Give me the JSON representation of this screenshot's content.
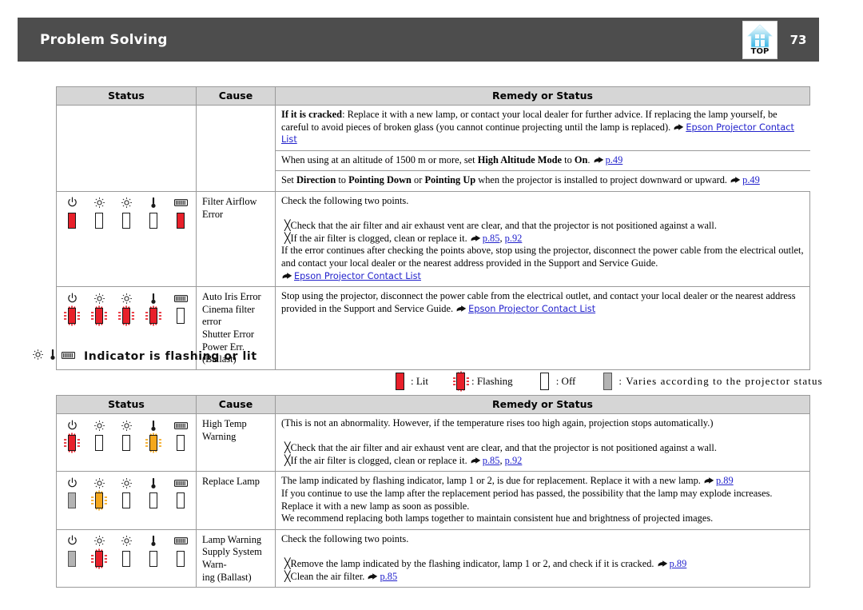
{
  "header": {
    "title": "Problem Solving",
    "page_number": "73",
    "top_icon_label": "TOP",
    "bar_color": "#4d4d4d"
  },
  "colors": {
    "lit": "#e8202a",
    "lit_orange": "#f5a81c",
    "off": "#ffffff",
    "varies": "#b3b3b3",
    "link": "#2222cc",
    "header_fill": "#d6d6d6"
  },
  "table1": {
    "headers": [
      "Status",
      "Cause",
      "Remedy or Status"
    ],
    "rows": [
      {
        "indicators": null,
        "cause": "",
        "remedies": [
          {
            "parts": [
              {
                "t": "b",
                "v": "If it is cracked"
              },
              {
                "t": "n",
                "v": ": Replace it with a new lamp, or contact your local dealer for further advice. If replacing the lamp yourself, be careful to avoid pieces of broken glass (you cannot continue projecting until the lamp is replaced). "
              },
              {
                "t": "hand"
              },
              {
                "t": "link",
                "v": "Epson Projector Contact List"
              }
            ]
          },
          {
            "parts": [
              {
                "t": "n",
                "v": "When using at an altitude of 1500 m or more, set "
              },
              {
                "t": "b",
                "v": "High Altitude Mode"
              },
              {
                "t": "n",
                "v": " to "
              },
              {
                "t": "b",
                "v": "On"
              },
              {
                "t": "n",
                "v": ". "
              },
              {
                "t": "hand"
              },
              {
                "t": "linkser",
                "v": "p.49"
              }
            ]
          },
          {
            "parts": [
              {
                "t": "n",
                "v": "Set "
              },
              {
                "t": "b",
                "v": "Direction"
              },
              {
                "t": "n",
                "v": " to "
              },
              {
                "t": "b",
                "v": "Pointing Down"
              },
              {
                "t": "n",
                "v": " or "
              },
              {
                "t": "b",
                "v": "Pointing Up"
              },
              {
                "t": "n",
                "v": " when the projector is installed to project downward or upward. "
              },
              {
                "t": "hand"
              },
              {
                "t": "linkser",
                "v": "p.49"
              }
            ]
          }
        ]
      },
      {
        "indicators": [
          {
            "icon": "power-icon",
            "state": "lit"
          },
          {
            "icon": "lamp1-icon",
            "state": "off"
          },
          {
            "icon": "lamp2-icon",
            "state": "off"
          },
          {
            "icon": "temp-icon",
            "state": "off"
          },
          {
            "icon": "filter-icon",
            "state": "lit"
          }
        ],
        "cause": "Filter Airflow Error",
        "remedies": [
          {
            "parts": [
              {
                "t": "n",
                "v": "Check the following two points."
              },
              {
                "t": "br"
              },
              {
                "t": "ind",
                "v": "╳Check that the air filter and air exhaust vent are clear, and that the projector is not positioned against a wall."
              },
              {
                "t": "ind2",
                "v": "╳If the air filter is clogged, clean or replace it. "
              },
              {
                "t": "hand"
              },
              {
                "t": "linkser",
                "v": "p.85"
              },
              {
                "t": "n",
                "v": ", "
              },
              {
                "t": "linkser",
                "v": "p.92"
              },
              {
                "t": "br"
              },
              {
                "t": "n",
                "v": "If the error continues after checking the points above, stop using the projector, disconnect the power cable from the electrical outlet, and contact your local dealer or the nearest address provided in the Support and Service Guide."
              },
              {
                "t": "br"
              },
              {
                "t": "hand"
              },
              {
                "t": "link",
                "v": "Epson Projector Contact List"
              }
            ]
          }
        ]
      },
      {
        "indicators": [
          {
            "icon": "power-icon",
            "state": "flash"
          },
          {
            "icon": "lamp1-icon",
            "state": "flash"
          },
          {
            "icon": "lamp2-icon",
            "state": "flash"
          },
          {
            "icon": "temp-icon",
            "state": "flash"
          },
          {
            "icon": "filter-icon",
            "state": "off"
          }
        ],
        "cause_lines": [
          "Auto Iris Error",
          "Cinema filter error",
          "Shutter Error",
          "Power Err. (Ballast)"
        ],
        "remedies": [
          {
            "parts": [
              {
                "t": "n",
                "v": "Stop using the projector, disconnect the power cable from the electrical outlet, and contact your local dealer or the nearest address provided in the Support and Service Guide. "
              },
              {
                "t": "hand"
              },
              {
                "t": "link",
                "v": "Epson Projector Contact List"
              }
            ]
          }
        ]
      }
    ]
  },
  "section": {
    "heading": "Indicator is flashing or lit",
    "heading_icons": [
      "lamp-icon",
      "temp-icon",
      "filter-icon"
    ],
    "legend": [
      {
        "state": "lit",
        "label": ": Lit"
      },
      {
        "state": "flash",
        "label": ": Flashing"
      },
      {
        "state": "off",
        "label": ": Off"
      },
      {
        "state": "varies",
        "label": ": Varies according to the projector status"
      }
    ]
  },
  "table2": {
    "headers": [
      "Status",
      "Cause",
      "Remedy or Status"
    ],
    "rows": [
      {
        "indicators": [
          {
            "icon": "power-icon",
            "state": "flash"
          },
          {
            "icon": "lamp1-icon",
            "state": "off"
          },
          {
            "icon": "lamp2-icon",
            "state": "off"
          },
          {
            "icon": "temp-icon",
            "state": "flash-orange"
          },
          {
            "icon": "filter-icon",
            "state": "off"
          }
        ],
        "cause": "High Temp Warning",
        "remedies": [
          {
            "parts": [
              {
                "t": "n",
                "v": "(This is not an abnormality. However, if the temperature rises too high again, projection stops automatically.)"
              },
              {
                "t": "br"
              },
              {
                "t": "ind",
                "v": "╳Check that the air filter and air exhaust vent are clear, and that the projector is not positioned against a wall."
              },
              {
                "t": "ind2",
                "v": "╳If the air filter is clogged, clean or replace it. "
              },
              {
                "t": "hand"
              },
              {
                "t": "linkser",
                "v": "p.85"
              },
              {
                "t": "n",
                "v": ", "
              },
              {
                "t": "linkser",
                "v": "p.92"
              }
            ]
          }
        ]
      },
      {
        "indicators": [
          {
            "icon": "power-icon",
            "state": "varies"
          },
          {
            "icon": "lamp1-icon",
            "state": "flash-orange"
          },
          {
            "icon": "lamp2-icon",
            "state": "off"
          },
          {
            "icon": "temp-icon",
            "state": "off"
          },
          {
            "icon": "filter-icon",
            "state": "off"
          }
        ],
        "cause": "Replace Lamp",
        "remedies": [
          {
            "parts": [
              {
                "t": "n",
                "v": "The lamp indicated by flashing indicator, lamp 1 or 2, is due for replacement. Replace it with a new lamp. "
              },
              {
                "t": "hand"
              },
              {
                "t": "linkser",
                "v": "p.89"
              },
              {
                "t": "br"
              },
              {
                "t": "n",
                "v": "If you continue to use the lamp after the replacement period has passed, the possibility that the lamp may explode increases. Replace it with a new lamp as soon as possible."
              },
              {
                "t": "br"
              },
              {
                "t": "n",
                "v": "We recommend replacing both lamps together to maintain consistent hue and brightness of projected images."
              }
            ]
          }
        ]
      },
      {
        "indicators": [
          {
            "icon": "power-icon",
            "state": "varies"
          },
          {
            "icon": "lamp1-icon",
            "state": "flash"
          },
          {
            "icon": "lamp2-icon",
            "state": "off"
          },
          {
            "icon": "temp-icon",
            "state": "off"
          },
          {
            "icon": "filter-icon",
            "state": "off"
          }
        ],
        "cause_lines": [
          "Lamp Warning",
          "Supply System Warn-",
          "ing (Ballast)"
        ],
        "remedies": [
          {
            "parts": [
              {
                "t": "n",
                "v": "Check the following two points."
              },
              {
                "t": "br"
              },
              {
                "t": "ind",
                "v": "╳Remove the lamp indicated by the flashing indicator, lamp 1 or 2, and check if it is cracked. "
              },
              {
                "t": "hand"
              },
              {
                "t": "linkser",
                "v": "p.89"
              },
              {
                "t": "ind2",
                "v": "╳Clean the air filter. "
              },
              {
                "t": "hand"
              },
              {
                "t": "linkser",
                "v": "p.85"
              }
            ]
          }
        ]
      }
    ]
  }
}
